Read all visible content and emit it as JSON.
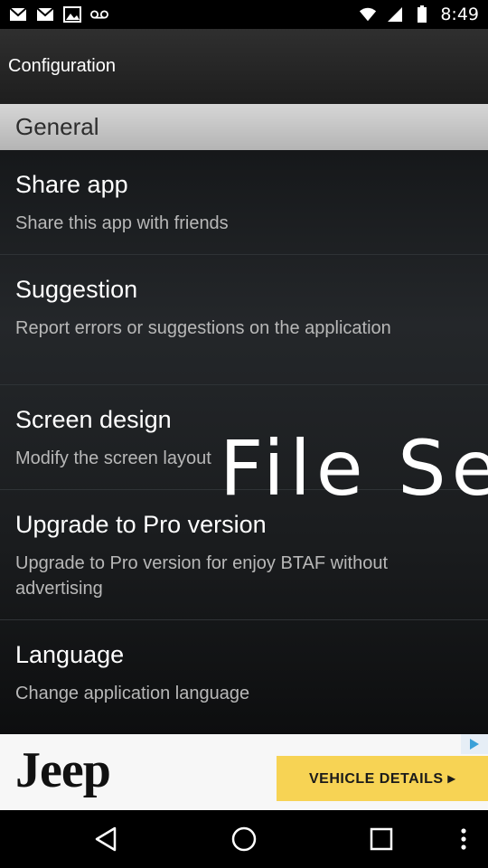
{
  "status_bar": {
    "time": "8:49",
    "left_icons": [
      "mail-icon",
      "mail-icon",
      "photo-icon",
      "voicemail-icon"
    ],
    "right_icons": [
      "wifi-icon",
      "signal-icon",
      "battery-icon"
    ]
  },
  "action_bar": {
    "title": "Configuration"
  },
  "section": {
    "title": "General"
  },
  "items": [
    {
      "title": "Share app",
      "summary": "Share this app with friends"
    },
    {
      "title": "Suggestion",
      "summary": "Report errors or suggestions on the application"
    },
    {
      "title": "Screen design",
      "summary": "Modify the screen layout"
    },
    {
      "title": "Upgrade to Pro version",
      "summary": "Upgrade to Pro version for enjoy BTAF without advertising"
    },
    {
      "title": "Language",
      "summary": "Change application language"
    }
  ],
  "overlay": {
    "text": "File Se"
  },
  "ad": {
    "brand": "Jeep",
    "cta": "VEHICLE DETAILS ▸",
    "badge_icon": "ad-choices-icon",
    "cta_color": "#f7d354"
  },
  "nav_bar": {
    "icons": [
      "back-icon",
      "home-icon",
      "recents-icon",
      "overflow-menu-icon"
    ]
  }
}
